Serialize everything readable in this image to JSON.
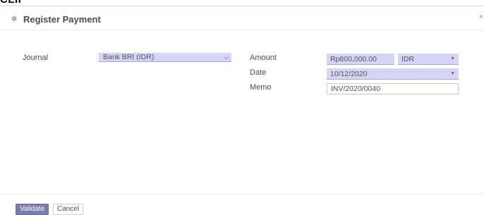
{
  "clipped_top_text": "CLII",
  "dialog": {
    "title": "Register Payment",
    "close_glyph": "×"
  },
  "form": {
    "journal_label": "Journal",
    "journal_value": "Bank BRI (IDR)",
    "amount_label": "Amount",
    "amount_value": "Rp800,000.00",
    "currency_value": "IDR",
    "date_label": "Date",
    "date_value": "10/12/2020",
    "memo_label": "Memo",
    "memo_value": "INV/2020/0040"
  },
  "footer": {
    "validate_label": "Validate",
    "cancel_label": "Cancel"
  },
  "icons": {
    "logo": "odoo-bug-icon",
    "journal_chevron": "chevron-down-icon",
    "currency_caret": "caret-down-icon",
    "date_caret": "caret-down-icon"
  },
  "colors": {
    "field_highlight": "#d7d5f7",
    "primary_button": "#7c7bad"
  }
}
